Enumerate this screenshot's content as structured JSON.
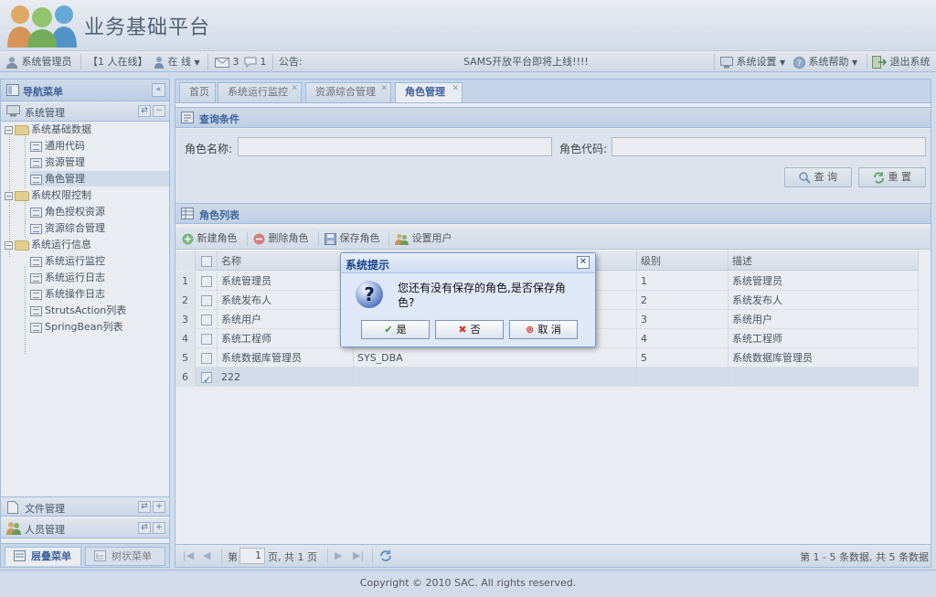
{
  "app": {
    "title": "业务基础平台"
  },
  "status": {
    "user": "系统管理员",
    "online_count": "【1 人在线】",
    "presence": "在 线",
    "mail_count": "3",
    "msg_count": "1",
    "notice_label": "公告:",
    "notice_text": "SAMS开放平台即将上线!!!!",
    "settings": "系统设置",
    "help": "系统帮助",
    "logout": "退出系统"
  },
  "nav": {
    "title": "导航菜单",
    "sections": [
      {
        "label": "系统管理"
      },
      {
        "label": "文件管理"
      },
      {
        "label": "人员管理"
      }
    ],
    "tree": [
      {
        "label": "系统基础数据"
      },
      {
        "label": "通用代码"
      },
      {
        "label": "资源管理"
      },
      {
        "label": "角色管理"
      },
      {
        "label": "系统权限控制"
      },
      {
        "label": "角色授权资源"
      },
      {
        "label": "资源综合管理"
      },
      {
        "label": "系统运行信息"
      },
      {
        "label": "系统运行监控"
      },
      {
        "label": "系统运行日志"
      },
      {
        "label": "系统操作日志"
      },
      {
        "label": "StrutsAction列表"
      },
      {
        "label": "SpringBean列表"
      }
    ],
    "bottom_tabs": [
      {
        "label": "层叠菜单"
      },
      {
        "label": "树状菜单"
      }
    ]
  },
  "tabs": [
    {
      "label": "首页"
    },
    {
      "label": "系统运行监控"
    },
    {
      "label": "资源综合管理"
    },
    {
      "label": "角色管理"
    }
  ],
  "query": {
    "title": "查询条件",
    "role_name_label": "角色名称:",
    "role_code_label": "角色代码:",
    "search_btn": "查 询",
    "reset_btn": "重 置"
  },
  "list": {
    "title": "角色列表",
    "toolbar": {
      "add": "新建角色",
      "delete": "删除角色",
      "save": "保存角色",
      "assign": "设置用户"
    },
    "columns": {
      "name": "名称",
      "level": "级别",
      "desc": "描述"
    },
    "rows": [
      {
        "no": "1",
        "name": "系统管理员",
        "code": "",
        "level": "1",
        "desc": "系统管理员"
      },
      {
        "no": "2",
        "name": "系统发布人",
        "code": "",
        "level": "2",
        "desc": "系统发布人"
      },
      {
        "no": "3",
        "name": "系统用户",
        "code": "",
        "level": "3",
        "desc": "系统用户"
      },
      {
        "no": "4",
        "name": "系统工程师",
        "code": "",
        "level": "4",
        "desc": "系统工程师"
      },
      {
        "no": "5",
        "name": "系统数据库管理员",
        "code": "SYS_DBA",
        "level": "5",
        "desc": "系统数据库管理员"
      },
      {
        "no": "6",
        "name": "222",
        "code": "",
        "level": "",
        "desc": ""
      }
    ]
  },
  "pager": {
    "page_prefix": "第",
    "page_value": "1",
    "page_suffix": "页, 共 1 页",
    "summary": "第 1 - 5 条数据, 共 5 条数据"
  },
  "footer": {
    "copyright": "Copyright © 2010 SAC. All rights reserved."
  },
  "dialog": {
    "title": "系统提示",
    "message": "您还有没有保存的角色,是否保存角色?",
    "yes": "是",
    "no": "否",
    "cancel": "取 消"
  }
}
